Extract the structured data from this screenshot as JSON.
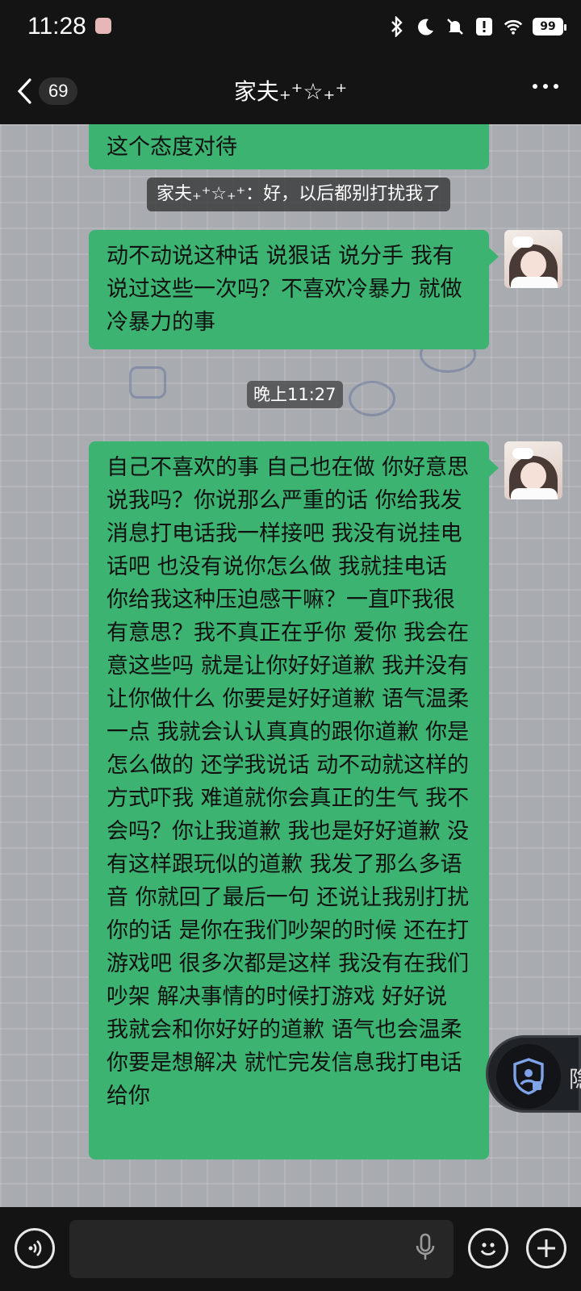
{
  "status_bar": {
    "time": "11:28",
    "battery": "99"
  },
  "nav": {
    "unread_count": "69",
    "title": "家夫₊⁺☆₊⁺"
  },
  "messages": {
    "partial_top": "这个态度对待",
    "system_notice": "家夫₊⁺☆₊⁺：好，以后都别打扰我了",
    "msg1": "动不动说这种话 说狠话 说分手 我有说过这些一次吗？不喜欢冷暴力 就做冷暴力的事",
    "timestamp": "晚上11:27",
    "msg2": "自己不喜欢的事 自己也在做 你好意思说我吗？你说那么严重的话 你给我发消息打电话我一样接吧 我没有说挂电话吧 也没有说你怎么做 我就挂电话 你给我这种压迫感干嘛？一直吓我很有意思？我不真正在乎你 爱你 我会在意这些吗 就是让你好好道歉 我并没有让你做什么 你要是好好道歉 语气温柔一点 我就会认认真真的跟你道歉 你是怎么做的 还学我说话 动不动就这样的方式吓我 难道就你会真正的生气 我不会吗？你让我道歉 我也是好好道歉 没有这样跟玩似的道歉 我发了那么多语音 你就回了最后一句 还说让我别打扰你的话 是你在我们吵架的时候 还在打游戏吧 很多次都是这样 我没有在我们吵架 解决事情的时候打游戏 好好说 我就会和你好好的道歉 语气也会温柔 你要是想解决 就忙完发信息我打电话给你"
  },
  "floating": {
    "privacy_label": "隐"
  },
  "input": {
    "placeholder": ""
  }
}
